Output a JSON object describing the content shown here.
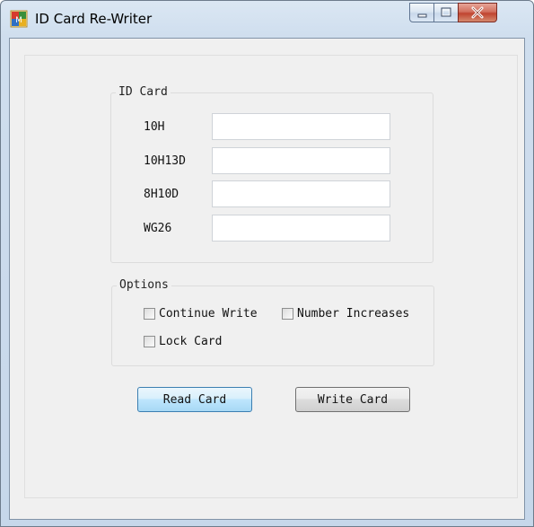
{
  "window": {
    "title": "ID Card Re-Writer",
    "icon": "app-icon"
  },
  "caption_buttons": {
    "minimize_icon": "minimize-icon",
    "maximize_icon": "maximize-icon",
    "close_icon": "close-icon"
  },
  "id_card": {
    "title": "ID Card",
    "fields": [
      {
        "label": "10H",
        "value": ""
      },
      {
        "label": "10H13D",
        "value": ""
      },
      {
        "label": "8H10D",
        "value": ""
      },
      {
        "label": "WG26",
        "value": ""
      }
    ]
  },
  "options": {
    "title": "Options",
    "checkboxes": [
      {
        "label": "Continue Write",
        "checked": false
      },
      {
        "label": "Number Increases",
        "checked": false
      },
      {
        "label": "Lock Card",
        "checked": false
      }
    ]
  },
  "actions": {
    "read_label": "Read Card",
    "write_label": "Write Card"
  }
}
